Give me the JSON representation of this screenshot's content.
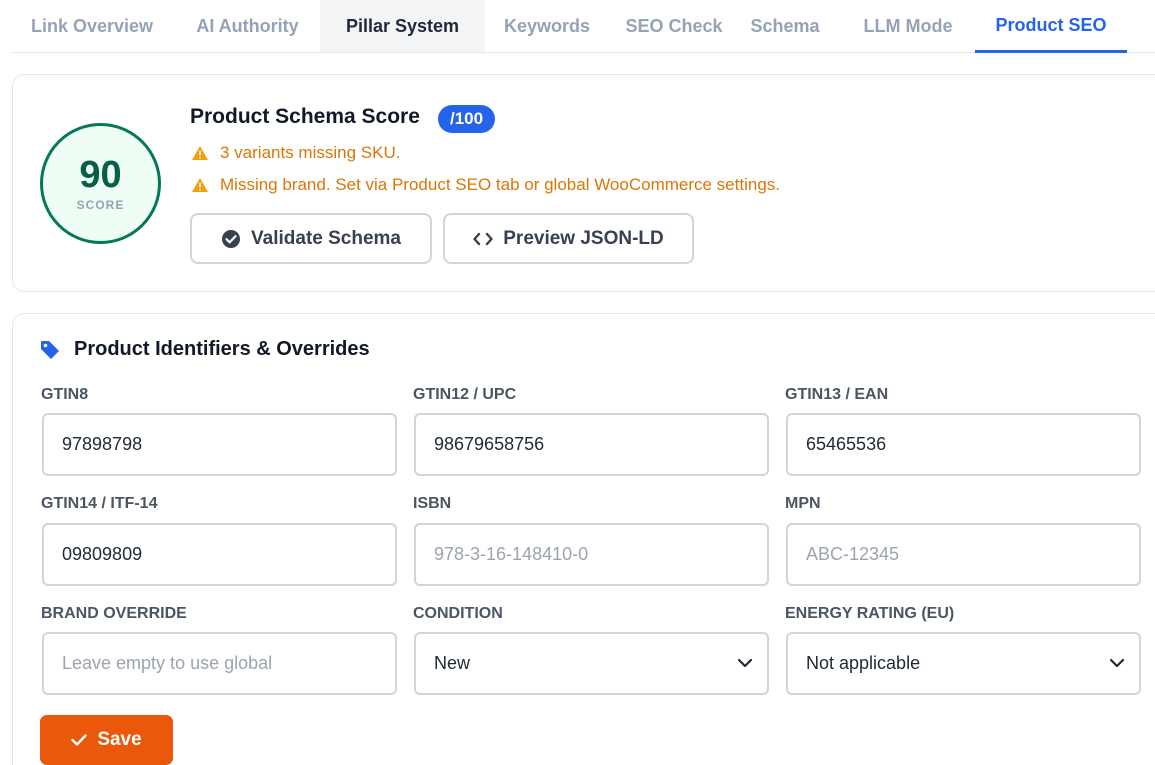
{
  "tabs": [
    {
      "label": "Link Overview"
    },
    {
      "label": "AI Authority"
    },
    {
      "label": "Pillar System"
    },
    {
      "label": "Keywords"
    },
    {
      "label": "SEO Check"
    },
    {
      "label": "Schema"
    },
    {
      "label": "LLM Mode"
    },
    {
      "label": "Product SEO"
    }
  ],
  "active_tab": "Product SEO",
  "score": {
    "value": "90",
    "label": "SCORE",
    "title": "Product Schema Score",
    "badge": "/100",
    "warnings": [
      "3 variants missing SKU.",
      "Missing brand. Set via Product SEO tab or global WooCommerce settings."
    ],
    "validate_label": "Validate Schema",
    "preview_label": "Preview JSON-LD"
  },
  "identifiers": {
    "title": "Product Identifiers & Overrides",
    "fields": [
      {
        "label": "GTIN8",
        "value": "97898798",
        "placeholder": ""
      },
      {
        "label": "GTIN12 / UPC",
        "value": "98679658756",
        "placeholder": ""
      },
      {
        "label": "GTIN13 / EAN",
        "value": "65465536",
        "placeholder": ""
      },
      {
        "label": "GTIN14 / ITF-14",
        "value": "09809809",
        "placeholder": ""
      },
      {
        "label": "ISBN",
        "value": "",
        "placeholder": "978-3-16-148410-0"
      },
      {
        "label": "MPN",
        "value": "",
        "placeholder": "ABC-12345"
      },
      {
        "label": "BRAND OVERRIDE",
        "value": "",
        "placeholder": "Leave empty to use global"
      },
      {
        "label": "CONDITION",
        "value": "New"
      },
      {
        "label": "ENERGY RATING (EU)",
        "value": "Not applicable"
      }
    ],
    "save_label": "Save"
  },
  "colors": {
    "accent": "#2563eb",
    "score_green": "#047857",
    "warning": "#d97706",
    "save": "#ea580c"
  }
}
